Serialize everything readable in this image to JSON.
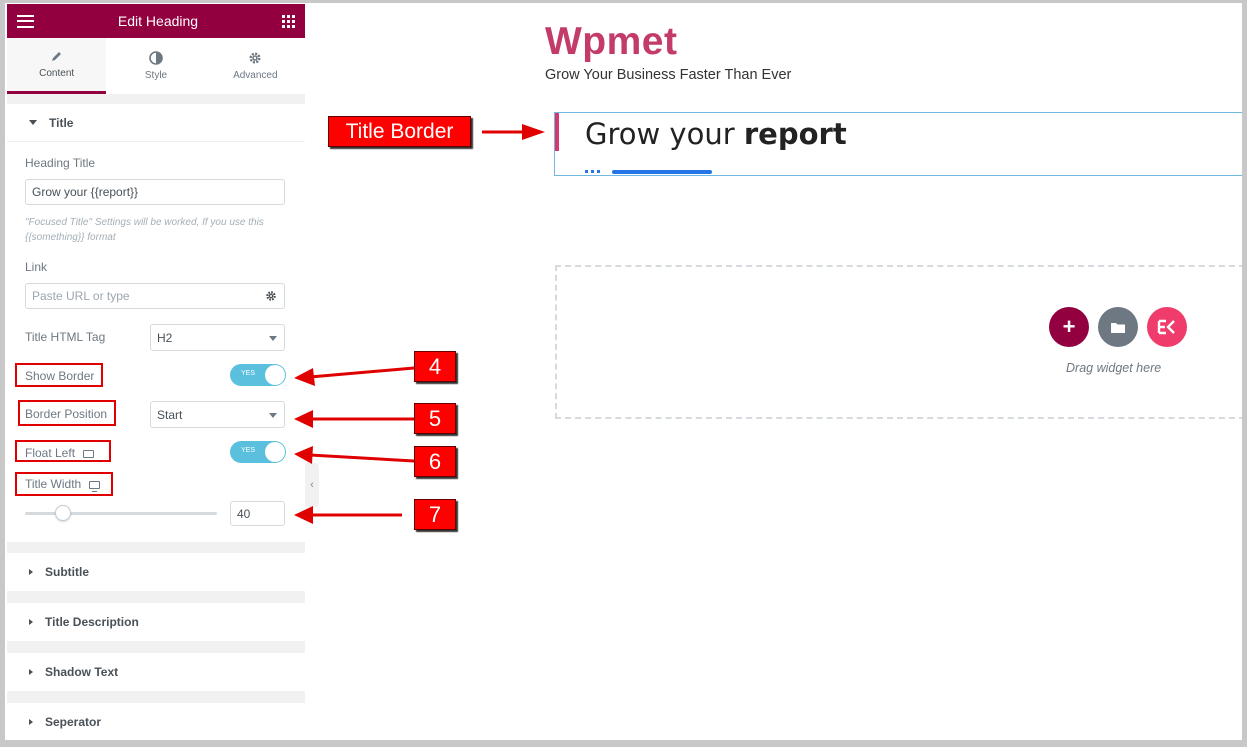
{
  "panel": {
    "header_title": "Edit Heading",
    "tabs": [
      {
        "label": "Content",
        "icon": "pencil-icon",
        "active": true
      },
      {
        "label": "Style",
        "icon": "half-circle-icon",
        "active": false
      },
      {
        "label": "Advanced",
        "icon": "gear-icon",
        "active": false
      }
    ],
    "title_section": {
      "label": "Title",
      "heading_title_label": "Heading Title",
      "heading_title_value": "Grow your {{report}}",
      "note": "\"Focused Title\" Settings will be worked, If you use this {{something}} format",
      "link_label": "Link",
      "link_placeholder": "Paste URL or type",
      "html_tag_label": "Title HTML Tag",
      "html_tag_value": "H2",
      "show_border_label": "Show Border",
      "show_border_toggle": "YES",
      "border_position_label": "Border Position",
      "border_position_value": "Start",
      "float_left_label": "Float Left",
      "float_left_toggle": "YES",
      "title_width_label": "Title Width",
      "title_width_value": "40",
      "title_width_slider_fraction": 0.2
    },
    "collapsed_sections": [
      "Subtitle",
      "Title Description",
      "Shadow Text",
      "Seperator"
    ]
  },
  "canvas": {
    "brand": "Wpmet",
    "tagline": "Grow Your Business Faster Than Ever",
    "heading_normal": "Grow your ",
    "heading_focused": "report",
    "drag_text": "Drag widget here",
    "buttons": [
      {
        "icon": "plus-icon",
        "color": "#93003f"
      },
      {
        "icon": "folder-icon",
        "color": "#6d7882"
      },
      {
        "icon": "elementskit-icon",
        "color": "#ef3c6c"
      }
    ]
  },
  "annotations": {
    "title_border": "Title Border",
    "callouts": [
      "4",
      "5",
      "6",
      "7"
    ]
  },
  "colors": {
    "panel_header": "#93003f",
    "brand": "#c23b6a",
    "border_accent": "#d6386d",
    "separator": "#2575e6",
    "toggle": "#5bc0de",
    "annotation_red": "#ff0000"
  }
}
